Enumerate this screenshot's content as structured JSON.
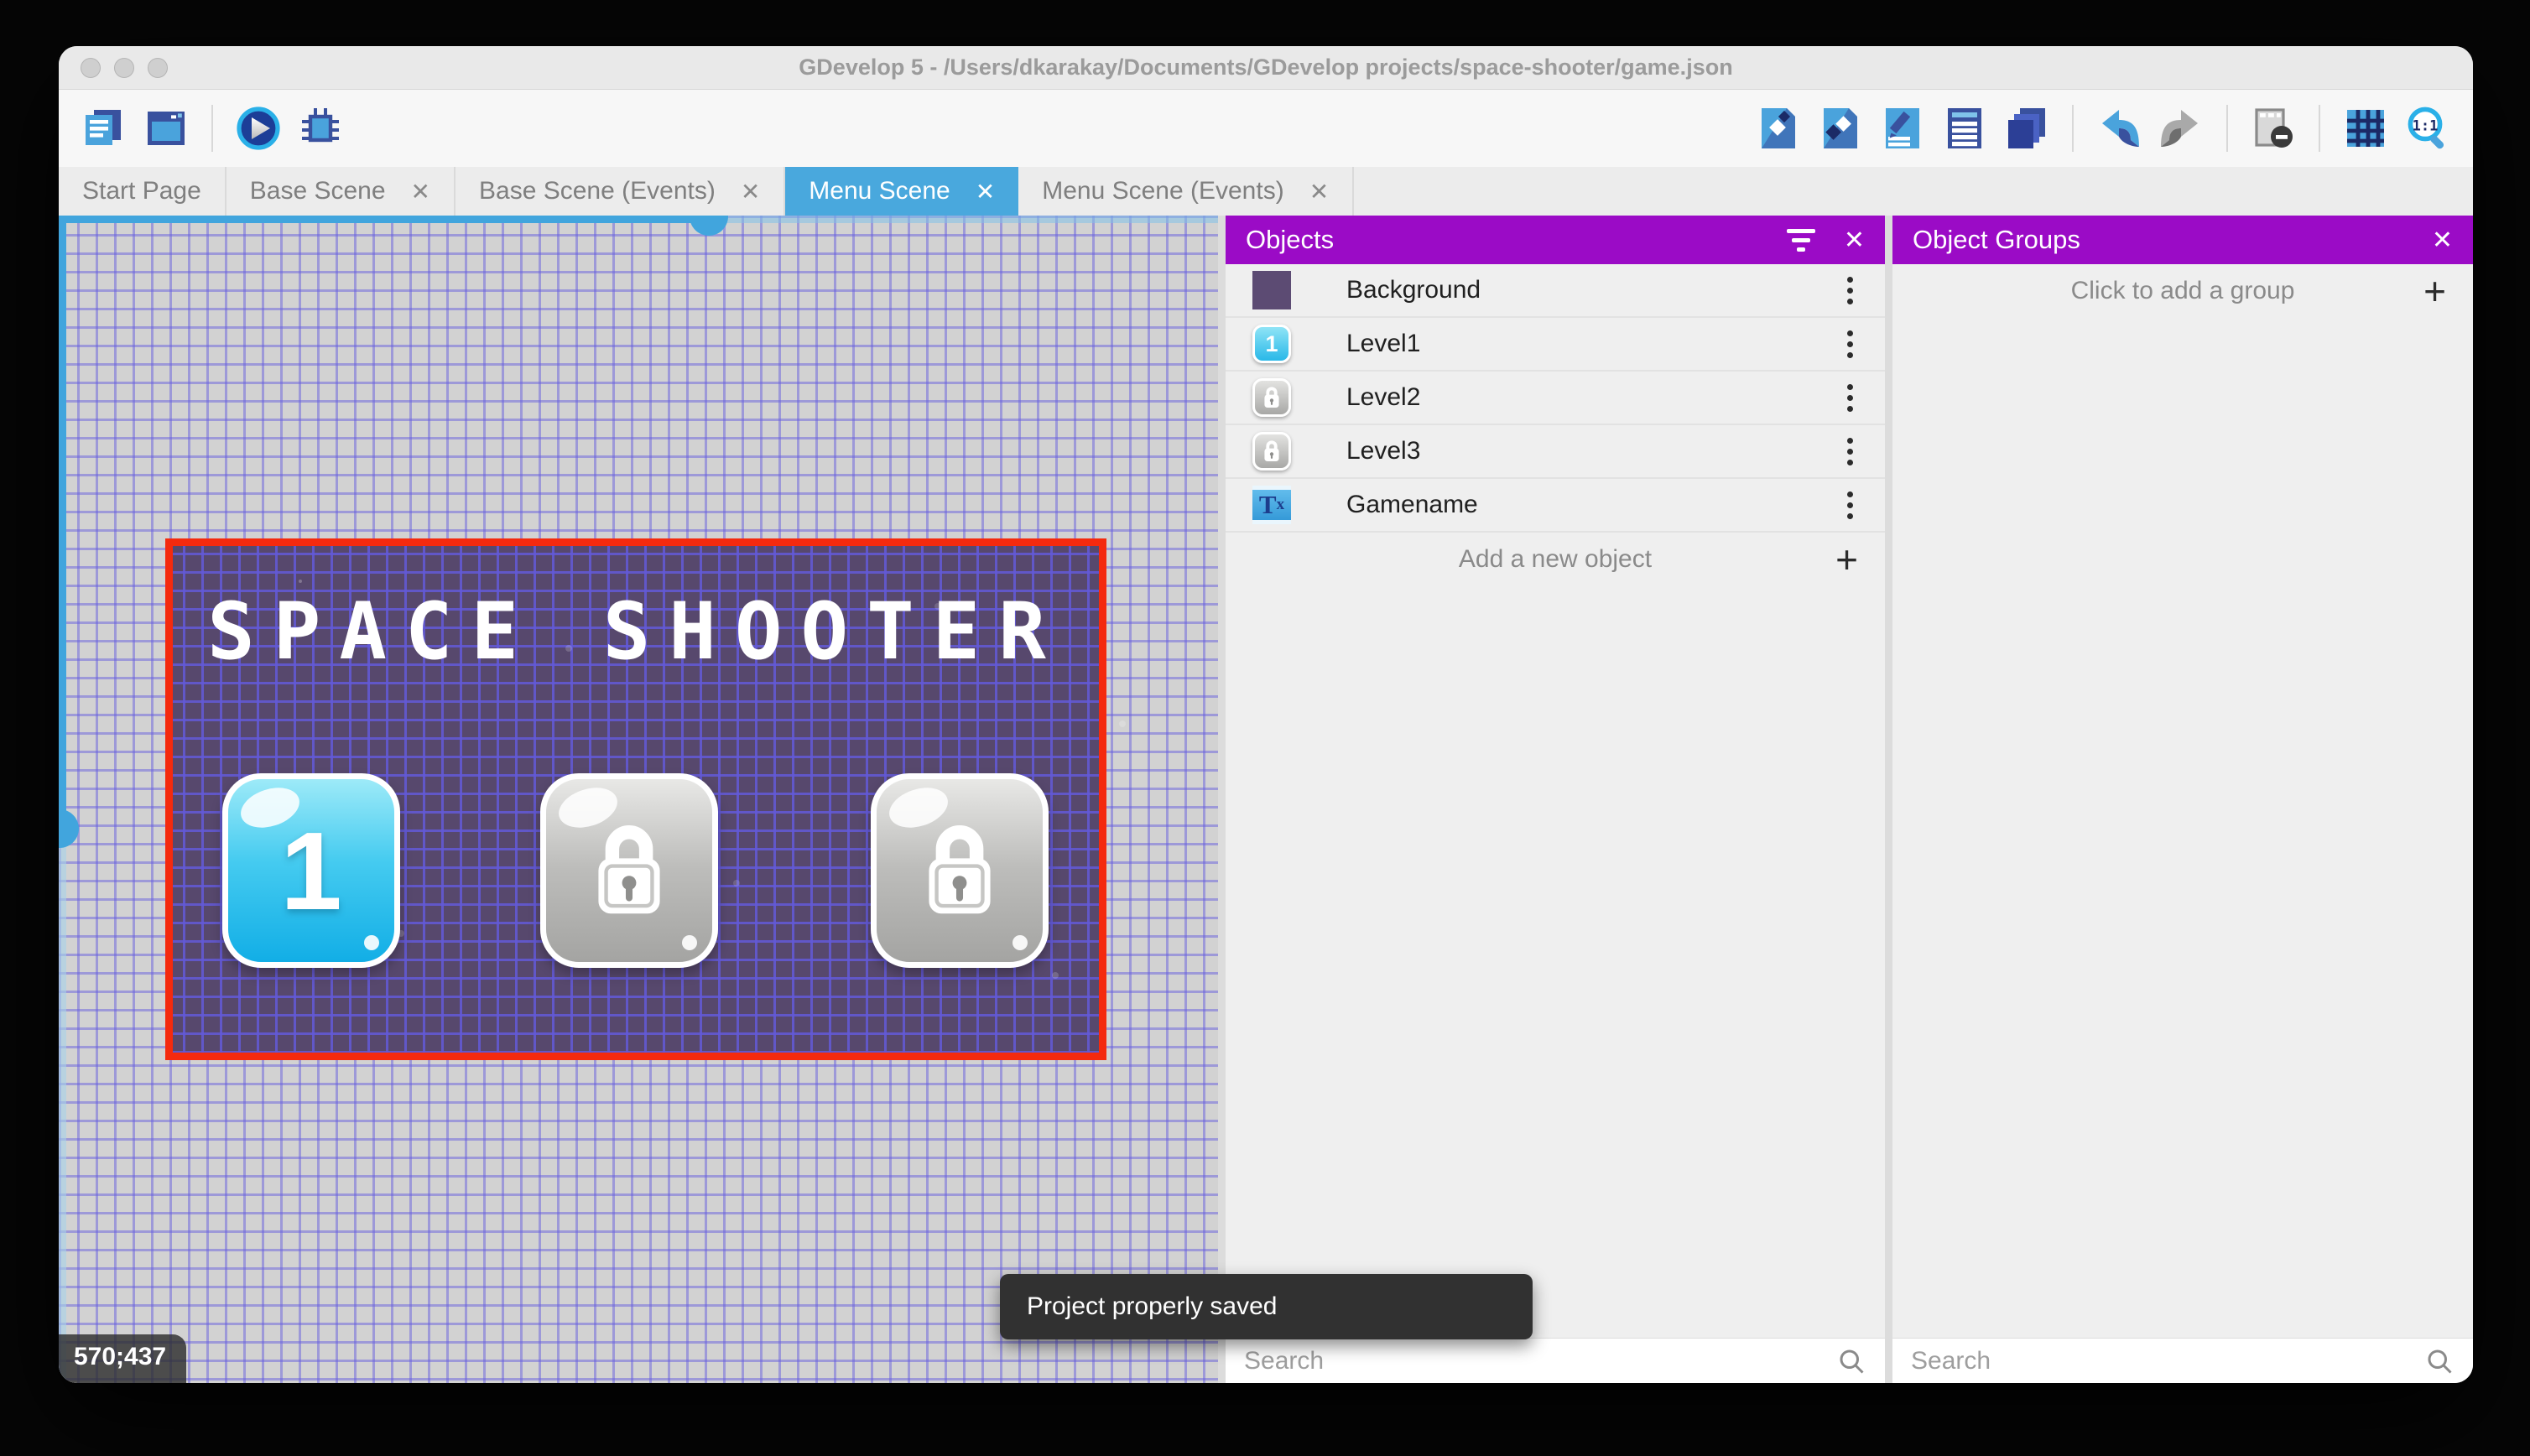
{
  "window": {
    "title": "GDevelop 5 - /Users/dkarakay/Documents/GDevelop projects/space-shooter/game.json"
  },
  "toolbar": {
    "left_icons": [
      "project-manager",
      "preview-window",
      "play",
      "debug"
    ],
    "right_icons": [
      "objects-editor",
      "object-groups-editor",
      "properties",
      "instances-list",
      "layers",
      "undo",
      "redo",
      "toggle-mask",
      "grid",
      "zoom-original"
    ]
  },
  "tabs": [
    {
      "label": "Start Page",
      "active": false,
      "closable": false
    },
    {
      "label": "Base Scene",
      "active": false,
      "closable": true
    },
    {
      "label": "Base Scene (Events)",
      "active": false,
      "closable": true
    },
    {
      "label": "Menu Scene",
      "active": true,
      "closable": true
    },
    {
      "label": "Menu Scene (Events)",
      "active": false,
      "closable": true
    }
  ],
  "scene": {
    "title": "SPACE SHOOTER",
    "level_buttons": [
      {
        "label": "1",
        "state": "unlocked"
      },
      {
        "label": "",
        "state": "locked"
      },
      {
        "label": "",
        "state": "locked"
      }
    ],
    "coordinates": "570;437"
  },
  "objects_panel": {
    "title": "Objects",
    "items": [
      {
        "name": "Background",
        "icon": "background-thumbnail"
      },
      {
        "name": "Level1",
        "icon": "level1-button-thumbnail"
      },
      {
        "name": "Level2",
        "icon": "locked-button-thumbnail"
      },
      {
        "name": "Level3",
        "icon": "locked-button-thumbnail"
      },
      {
        "name": "Gamename",
        "icon": "text-object-thumbnail"
      }
    ],
    "add_label": "Add a new object",
    "search_placeholder": "Search"
  },
  "groups_panel": {
    "title": "Object Groups",
    "add_label": "Click to add a group",
    "search_placeholder": "Search"
  },
  "toast": {
    "message": "Project properly saved"
  },
  "icons": {
    "close": "✕",
    "plus": "+",
    "tx_main": "T",
    "tx_sub": "x"
  },
  "colors": {
    "panel_header": "#9b0bc6",
    "active_tab": "#49a8dd",
    "selection_border": "#f42a0e",
    "scene_background": "#57486d",
    "scrollbar": "#41a5dd",
    "canvas_background": "#d2d2d2"
  }
}
